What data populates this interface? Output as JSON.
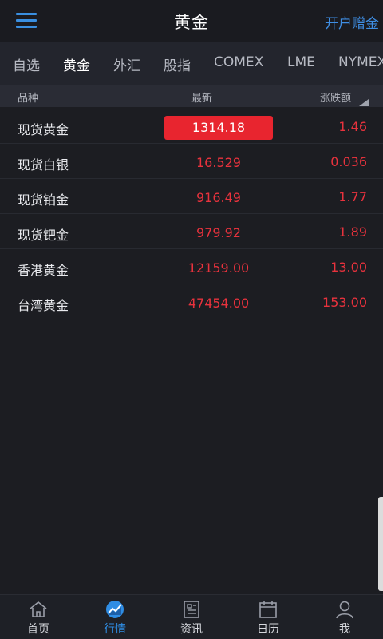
{
  "header": {
    "title": "黄金",
    "right_link": "开户赠金"
  },
  "tabs": [
    {
      "label": "自选"
    },
    {
      "label": "黄金"
    },
    {
      "label": "外汇"
    },
    {
      "label": "股指"
    },
    {
      "label": "COMEX"
    },
    {
      "label": "LME"
    },
    {
      "label": "NYMEX"
    }
  ],
  "active_tab": "黄金",
  "columns": {
    "name": "品种",
    "latest": "最新",
    "change": "涨跌额"
  },
  "rows": [
    {
      "name": "现货黄金",
      "latest": "1314.18",
      "change": "1.46",
      "highlighted": true
    },
    {
      "name": "现货白银",
      "latest": "16.529",
      "change": "0.036"
    },
    {
      "name": "现货铂金",
      "latest": "916.49",
      "change": "1.77"
    },
    {
      "name": "现货钯金",
      "latest": "979.92",
      "change": "1.89"
    },
    {
      "name": "香港黄金",
      "latest": "12159.00",
      "change": "13.00"
    },
    {
      "name": "台湾黄金",
      "latest": "47454.00",
      "change": "153.00"
    }
  ],
  "bottom_nav": [
    {
      "label": "首页",
      "icon": "home-icon"
    },
    {
      "label": "行情",
      "icon": "market-chart-icon",
      "active": true
    },
    {
      "label": "资讯",
      "icon": "news-icon"
    },
    {
      "label": "日历",
      "icon": "calendar-icon"
    },
    {
      "label": "我",
      "icon": "profile-icon"
    }
  ],
  "colors": {
    "accent": "#2f8de4",
    "up_red": "#e8323d",
    "background": "#1c1d22"
  }
}
